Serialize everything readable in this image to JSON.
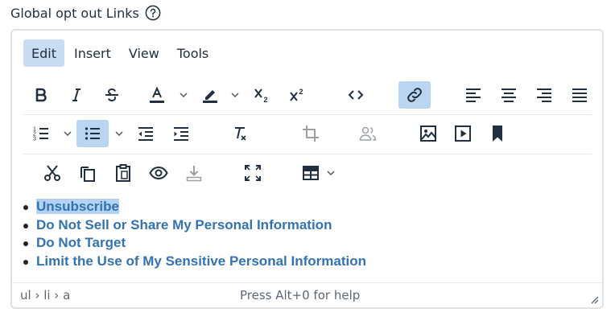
{
  "field": {
    "label": "Global opt out Links",
    "help_icon": "question-circle-icon"
  },
  "menubar": {
    "items": [
      {
        "label": "Edit",
        "active": true
      },
      {
        "label": "Insert",
        "active": false
      },
      {
        "label": "View",
        "active": false
      },
      {
        "label": "Tools",
        "active": false
      }
    ]
  },
  "toolbar": {
    "subscript_label": "X₂",
    "superscript_label": "X²"
  },
  "content": {
    "links": [
      "Unsubscribe",
      "Do Not Sell or Share My Personal Information",
      "Do Not Target",
      "Limit the Use of My Sensitive Personal Information"
    ]
  },
  "statusbar": {
    "path": "ul › li › a",
    "help": "Press Alt+0 for help"
  },
  "colors": {
    "accent": "#3373b3",
    "selection": "#b4d2f2",
    "active_button": "#b9d5f0"
  }
}
